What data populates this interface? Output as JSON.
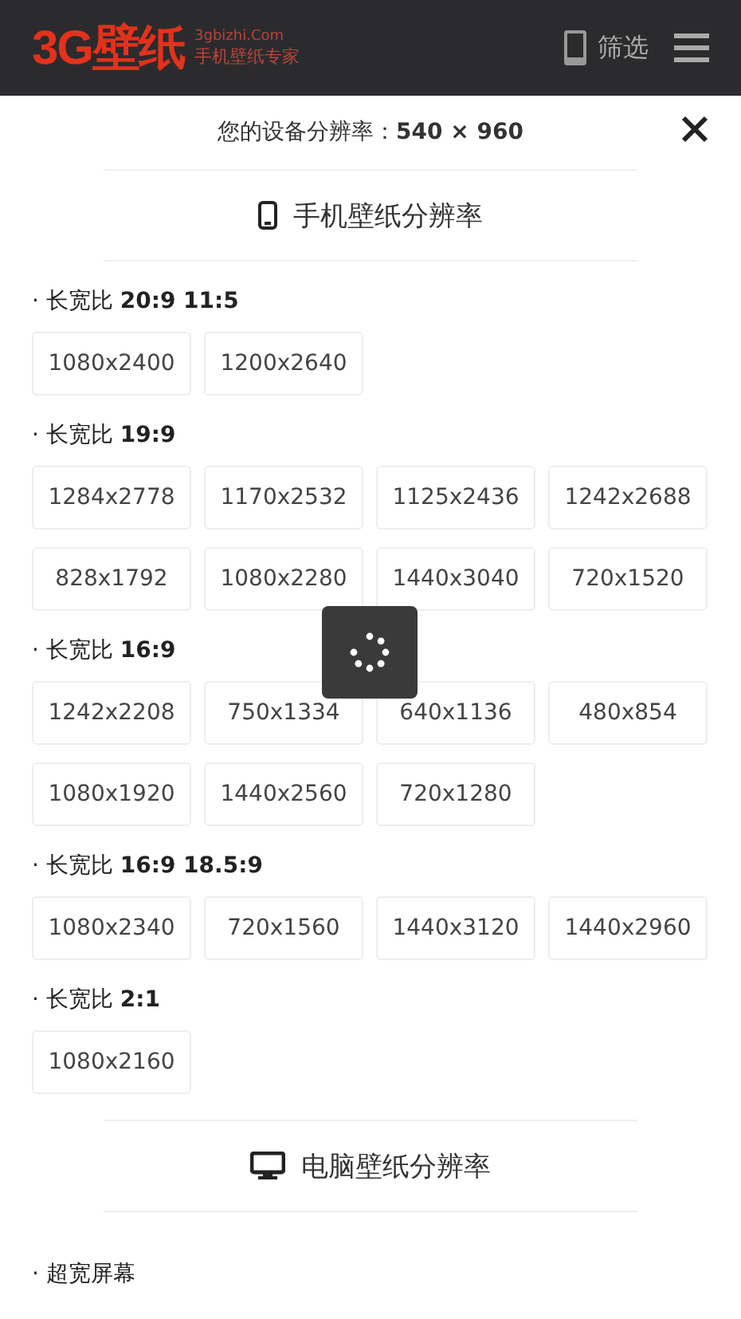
{
  "header": {
    "logo": {
      "brand": "3G壁纸",
      "domain": "3gbizhi.Com",
      "slogan": "手机壁纸专家"
    },
    "filter_label": "筛选"
  },
  "device": {
    "label": "您的设备分辨率：",
    "value": "540 × 960"
  },
  "sections": [
    {
      "title": "手机壁纸分辨率",
      "groups": [
        {
          "label": "· 长宽比 **20:9 11:5**",
          "options": [
            "1080x2400",
            "1200x2640"
          ]
        },
        {
          "label": "· 长宽比 **19:9**",
          "options": [
            "1284x2778",
            "1170x2532",
            "1125x2436",
            "1242x2688",
            "828x1792",
            "1080x2280",
            "1440x3040",
            "720x1520"
          ]
        },
        {
          "label": "· 长宽比 **16:9**",
          "options": [
            "1242x2208",
            "750x1334",
            "640x1136",
            "480x854",
            "1080x1920",
            "1440x2560",
            "720x1280"
          ]
        },
        {
          "label": "· 长宽比 **16:9 18.5:9**",
          "options": [
            "1080x2340",
            "720x1560",
            "1440x3120",
            "1440x2960"
          ]
        },
        {
          "label": "· 长宽比 **2:1**",
          "options": [
            "1080x2160"
          ]
        }
      ]
    },
    {
      "title": "电脑壁纸分辨率",
      "groups": [
        {
          "label": "· 超宽屏幕"
        }
      ]
    }
  ],
  "loading": true
}
